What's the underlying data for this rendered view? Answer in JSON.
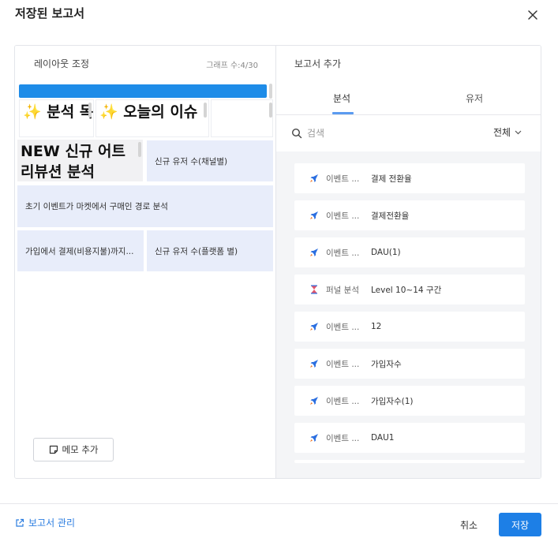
{
  "modal": {
    "title": "저장된 보고서",
    "close_icon": "close-icon"
  },
  "layout_panel": {
    "title": "레이아웃 조정",
    "graph_count": "그래프 수:4/30",
    "bar_color": "#1e8ce8",
    "big_cards": [
      {
        "text": "✨ 분석 목록",
        "emoji_icon": "sparkles-icon"
      },
      {
        "text": "✨ 오늘의 이슈",
        "emoji_icon": "sparkles-icon"
      },
      {
        "text": ""
      }
    ],
    "new_card_text": "NEW 신규 어트리뷰션 분석",
    "graph_cards": [
      "신규 유저 수(채널별)",
      "초기 이벤트가 마켓에서 구매인 경로 분석",
      "가입에서 결제(비용지불)까지...",
      "신규 유저 수(플랫폼 별)"
    ],
    "memo_button": "메모 추가",
    "memo_icon": "note-icon"
  },
  "add_panel": {
    "title": "보고서 추가",
    "tabs": [
      {
        "label": "분석",
        "active": true
      },
      {
        "label": "유저",
        "active": false
      }
    ],
    "search": {
      "placeholder": "검색",
      "value": ""
    },
    "filter": {
      "label": "전체",
      "icon": "chevron-down-icon"
    },
    "items": [
      {
        "icon": "rocket-icon",
        "type": "이벤트 ...",
        "name": "결제 전환율"
      },
      {
        "icon": "rocket-icon",
        "type": "이벤트 ...",
        "name": "결제전환율"
      },
      {
        "icon": "rocket-icon",
        "type": "이벤트 ...",
        "name": "DAU(1)"
      },
      {
        "icon": "hourglass-icon",
        "type": "퍼널 분석",
        "name": "Level 10~14 구간"
      },
      {
        "icon": "rocket-icon",
        "type": "이벤트 ...",
        "name": "12"
      },
      {
        "icon": "rocket-icon",
        "type": "이벤트 ...",
        "name": "가입자수"
      },
      {
        "icon": "rocket-icon",
        "type": "이벤트 ...",
        "name": "가입자수(1)"
      },
      {
        "icon": "rocket-icon",
        "type": "이벤트 ...",
        "name": "DAU1"
      }
    ]
  },
  "footer": {
    "manage_link": "보고서 관리",
    "manage_icon": "external-link-icon",
    "cancel": "취소",
    "save": "저장",
    "accent_color": "#1d7fe6"
  }
}
